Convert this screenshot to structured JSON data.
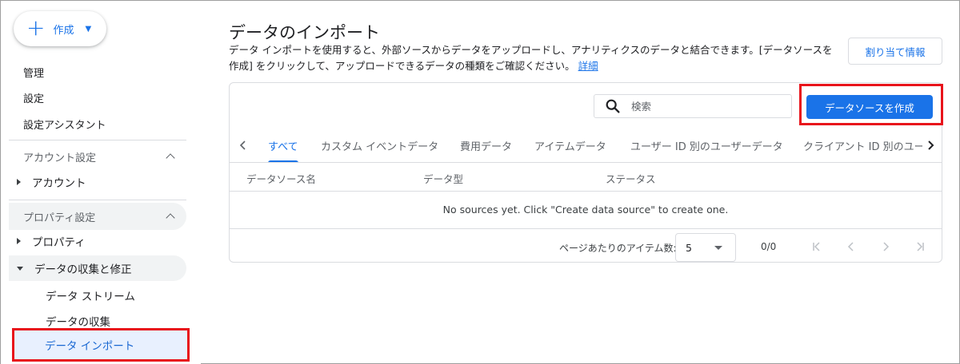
{
  "sidebar": {
    "create_label": "作成",
    "items": {
      "admin": "管理",
      "settings": "設定",
      "setup_assistant": "設定アシスタント"
    },
    "account_section": {
      "title": "アカウント設定",
      "account": "アカウント"
    },
    "property_section": {
      "title": "プロパティ設定",
      "property": "プロパティ",
      "data_collection_modification": "データの収集と修正",
      "data_streams": "データ ストリーム",
      "data_collection": "データの収集",
      "data_import": "データ インポート"
    }
  },
  "main": {
    "title": "データのインポート",
    "description": "データ インポートを使用すると、外部ソースからデータをアップロードし、アナリティクスのデータと結合できます。[データソースを作成] をクリックして、アップロードできるデータの種類をご確認ください。",
    "learn_more": "詳細",
    "assign_button": "割り当て情報",
    "search_placeholder": "検索",
    "create_data_source_button": "データソースを作成",
    "tabs": [
      "すべて",
      "カスタム イベントデータ",
      "費用データ",
      "アイテムデータ",
      "ユーザー ID 別のユーザーデータ",
      "クライアント ID 別のユーザーデータ"
    ],
    "columns": [
      "データソース名",
      "データ型",
      "ステータス"
    ],
    "empty_message": "No sources yet. Click \"Create data source\" to create one.",
    "pager": {
      "items_per_page_label": "ページあたりのアイテム数:",
      "items_per_page": "5",
      "range": "0/0"
    }
  },
  "colors": {
    "accent": "#1a73e8",
    "highlight": "#e8131b",
    "active_bg": "#e8f0fe"
  }
}
